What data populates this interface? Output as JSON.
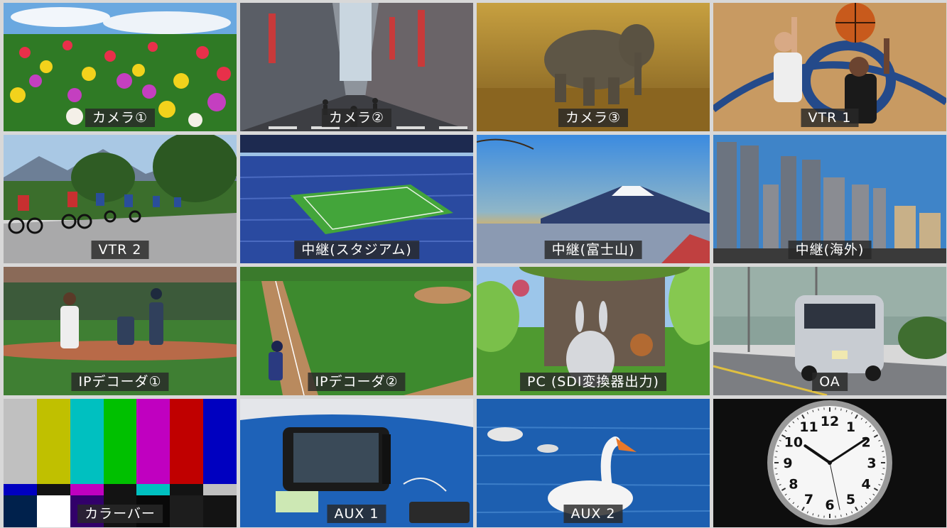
{
  "tiles": [
    {
      "id": "camera1",
      "label": "カメラ①",
      "tally": "program"
    },
    {
      "id": "camera2",
      "label": "カメラ②",
      "tally": "none"
    },
    {
      "id": "camera3",
      "label": "カメラ③",
      "tally": "none"
    },
    {
      "id": "vtr1",
      "label": "VTR 1",
      "tally": "none"
    },
    {
      "id": "vtr2",
      "label": "VTR 2",
      "tally": "none"
    },
    {
      "id": "relay-stadium",
      "label": "中継(スタジアム)",
      "tally": "preview"
    },
    {
      "id": "relay-fuji",
      "label": "中継(富士山)",
      "tally": "none"
    },
    {
      "id": "relay-overseas",
      "label": "中継(海外)",
      "tally": "none"
    },
    {
      "id": "ip-decoder1",
      "label": "IPデコーダ①",
      "tally": "none"
    },
    {
      "id": "ip-decoder2",
      "label": "IPデコーダ②",
      "tally": "none"
    },
    {
      "id": "pc-sdi",
      "label": "PC (SDI変換器出力)",
      "tally": "none"
    },
    {
      "id": "oa",
      "label": "OA",
      "tally": "none"
    },
    {
      "id": "color-bars",
      "label": "カラーバー",
      "tally": "none"
    },
    {
      "id": "aux1",
      "label": "AUX 1",
      "tally": "none"
    },
    {
      "id": "aux2",
      "label": "AUX 2",
      "tally": "none"
    },
    {
      "id": "clock",
      "label": "",
      "tally": "none"
    }
  ],
  "colors": {
    "program_tally": "#d42020",
    "preview_tally": "#2ec92e",
    "bars_top": [
      "#c0c0c0",
      "#c0c000",
      "#00c0c0",
      "#00c000",
      "#c000c0",
      "#c00000",
      "#0000c0"
    ],
    "bars_mid": [
      "#0000c0",
      "#131313",
      "#c000c0",
      "#131313",
      "#00c0c0",
      "#131313",
      "#c0c0c0"
    ],
    "bars_bot": [
      "#00214c",
      "#ffffff",
      "#32006a",
      "#131313",
      "#090909",
      "#1d1d1d",
      "#131313"
    ]
  },
  "clock": {
    "numbers": [
      "12",
      "1",
      "2",
      "3",
      "4",
      "5",
      "6",
      "7",
      "8",
      "9",
      "10",
      "11"
    ],
    "time": "10:09:28"
  }
}
